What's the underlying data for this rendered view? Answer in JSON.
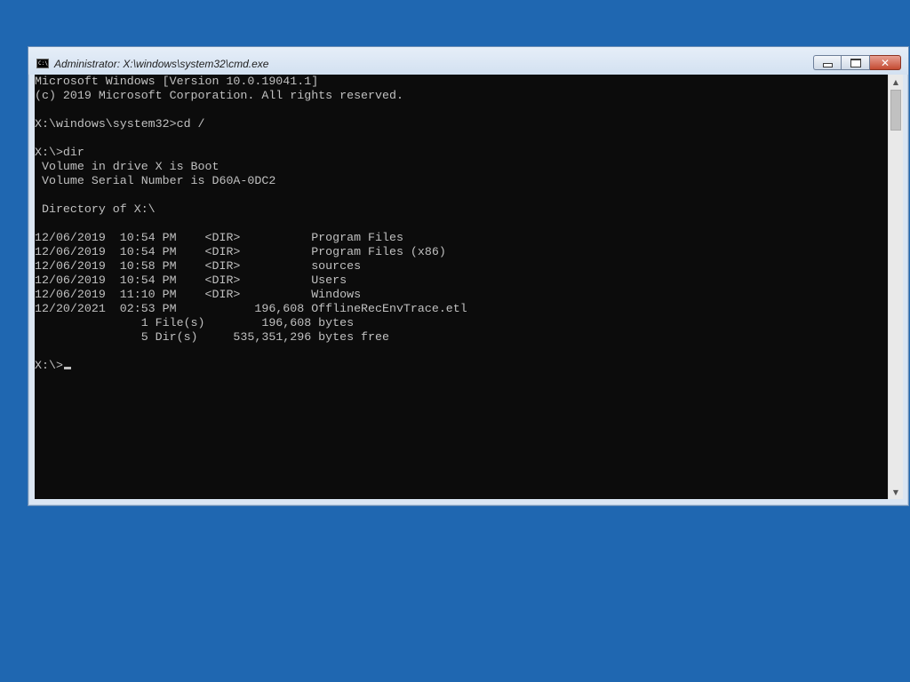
{
  "window": {
    "title": "Administrator: X:\\windows\\system32\\cmd.exe",
    "icon_label": "C:\\"
  },
  "caption_buttons": {
    "minimize_icon": "minimize-icon",
    "maximize_icon": "restore-icon",
    "close_icon": "close-icon",
    "close_glyph": "✕"
  },
  "console": {
    "lines": [
      "Microsoft Windows [Version 10.0.19041.1]",
      "(c) 2019 Microsoft Corporation. All rights reserved.",
      "",
      "X:\\windows\\system32>cd /",
      "",
      "X:\\>dir",
      " Volume in drive X is Boot",
      " Volume Serial Number is D60A-0DC2",
      "",
      " Directory of X:\\",
      "",
      "12/06/2019  10:54 PM    <DIR>          Program Files",
      "12/06/2019  10:54 PM    <DIR>          Program Files (x86)",
      "12/06/2019  10:58 PM    <DIR>          sources",
      "12/06/2019  10:54 PM    <DIR>          Users",
      "12/06/2019  11:10 PM    <DIR>          Windows",
      "12/20/2021  02:53 PM           196,608 OfflineRecEnvTrace.etl",
      "               1 File(s)        196,608 bytes",
      "               5 Dir(s)     535,351,296 bytes free",
      "",
      "X:\\>"
    ]
  },
  "scrollbar": {
    "up_arrow": "▲",
    "down_arrow": "▼"
  },
  "colors": {
    "desktop": "#1f67b1",
    "console_background": "#0c0c0c",
    "console_text": "#c0c0c0"
  }
}
